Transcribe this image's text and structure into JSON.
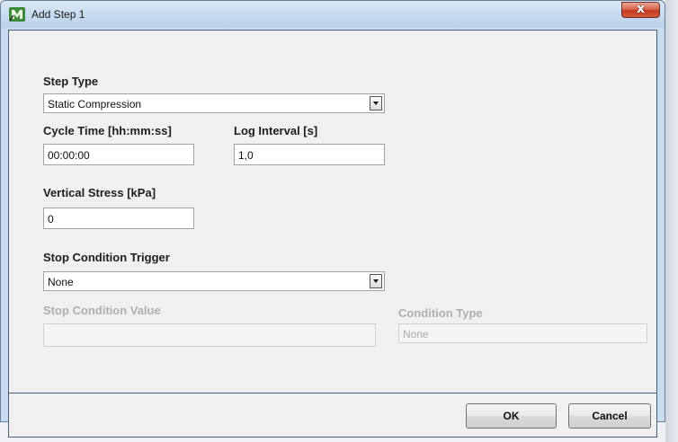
{
  "window": {
    "title": "Add Step 1",
    "close_glyph": "x",
    "icon": "app-logo-icon"
  },
  "form": {
    "step_type": {
      "label": "Step Type",
      "value": "Static Compression"
    },
    "cycle_time": {
      "label": "Cycle Time [hh:mm:ss]",
      "value": "00:00:00"
    },
    "log_interval": {
      "label": "Log Interval [s]",
      "value": "1,0"
    },
    "vertical_stress": {
      "label": "Vertical Stress [kPa]",
      "value": "0"
    },
    "stop_trigger": {
      "label": "Stop Condition Trigger",
      "value": "None"
    },
    "stop_value": {
      "label": "Stop Condition Value",
      "value": ""
    },
    "condition_type": {
      "label": "Condition Type",
      "value": "None"
    }
  },
  "buttons": {
    "ok": "OK",
    "cancel": "Cancel"
  }
}
